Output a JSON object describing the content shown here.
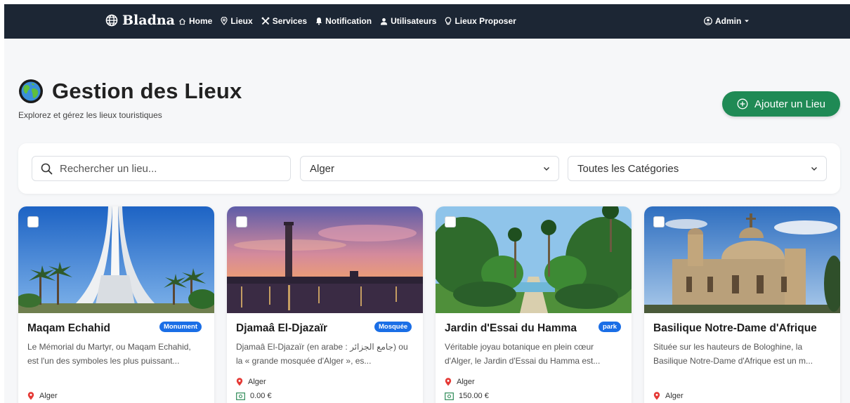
{
  "navbar": {
    "brand": "Bladna",
    "links": [
      "Home",
      "Lieux",
      "Services",
      "Notification",
      "Utilisateurs",
      "Lieux Proposer"
    ],
    "admin": "Admin"
  },
  "header": {
    "title": "Gestion des Lieux",
    "subtitle": "Explorez et gérez les lieux touristiques",
    "add_button": "Ajouter un Lieu"
  },
  "filters": {
    "search_placeholder": "Rechercher un lieu...",
    "city": "Alger",
    "category": "Toutes les Catégories"
  },
  "cards": [
    {
      "title": "Maqam Echahid",
      "badge": "Monument",
      "description": "Le Mémorial du Martyr, ou Maqam Echahid, est l'un des symboles les plus puissant...",
      "location": "Alger",
      "price": ""
    },
    {
      "title": "Djamaâ El-Djazaïr",
      "badge": "Mosquée",
      "description": "Djamaâ El-Djazaïr (en arabe : جامع الجزائر) ou la « grande mosquée d'Alger », es...",
      "location": "Alger",
      "price": "0.00 €"
    },
    {
      "title": "Jardin d'Essai du Hamma",
      "badge": "park",
      "description": "Véritable joyau botanique en plein cœur d'Alger, le Jardin d'Essai du Hamma est...",
      "location": "Alger",
      "price": "150.00 €"
    },
    {
      "title": "Basilique Notre-Dame d'Afrique",
      "badge": "",
      "description": "Située sur les hauteurs de Bologhine, la Basilique Notre-Dame d'Afrique est un m...",
      "location": "Alger",
      "price": ""
    }
  ],
  "colors": {
    "navbar": "#1c2634",
    "accent_green": "#1f8a55",
    "badge_blue": "#1a6ee6",
    "location_red": "#e53935",
    "price_green": "#2e8b57"
  },
  "icons": {
    "brand": "globe-icon",
    "home": "home-icon",
    "lieux": "map-pin-icon",
    "services": "tools-icon",
    "notification": "bell-icon",
    "utilisateurs": "user-icon",
    "lieux_proposer": "lightbulb-icon",
    "admin": "user-circle-icon",
    "title": "earth-icon",
    "add": "plus-circle-icon",
    "search": "search-icon",
    "location": "location-pin-icon",
    "price": "money-icon"
  }
}
